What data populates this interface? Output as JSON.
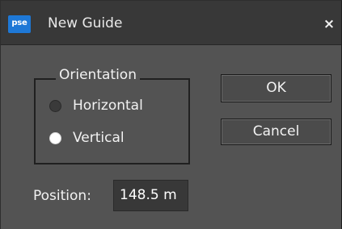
{
  "window": {
    "app_badge": "pse",
    "title": "New Guide",
    "close_glyph": "×"
  },
  "orientation_group": {
    "legend": "Orientation",
    "options": [
      {
        "label": "Horizontal",
        "selected": false
      },
      {
        "label": "Vertical",
        "selected": true
      }
    ]
  },
  "buttons": {
    "ok_label": "OK",
    "cancel_label": "Cancel"
  },
  "position": {
    "label": "Position:",
    "value": "148.5 m"
  },
  "icons": {
    "app_badge": "pse-app-icon",
    "close": "close-icon",
    "radio_off": "radio-unselected-icon",
    "radio_on": "radio-selected-icon"
  },
  "colors": {
    "dialog_background": "#535353",
    "titlebar_background": "#383838",
    "app_badge_blue": "#1e78d6",
    "text": "#f2f2f2"
  }
}
